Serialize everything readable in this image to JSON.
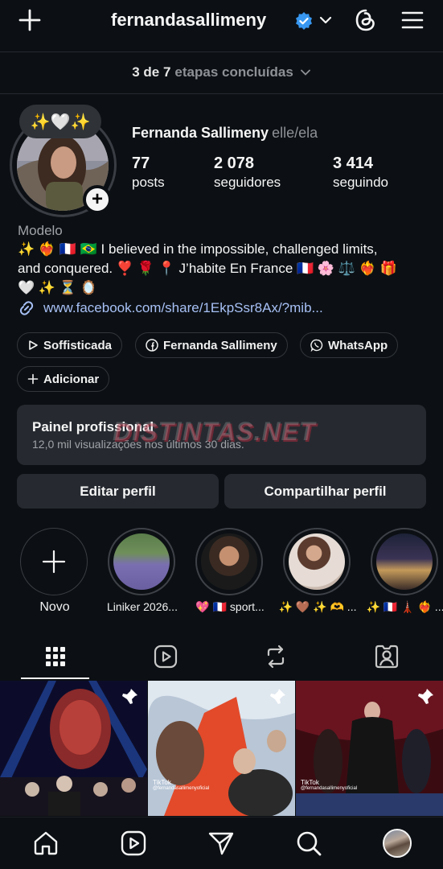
{
  "header": {
    "username": "fernandasallimeny"
  },
  "steps": {
    "count": "3 de 7",
    "text": "etapas concluídas"
  },
  "profile": {
    "note_emoji": "✨🤍✨",
    "full_name": "Fernanda Sallimeny",
    "pronouns": "elle/ela",
    "stats": [
      {
        "value": "77",
        "label": "posts"
      },
      {
        "value": "2 078",
        "label": "seguidores"
      },
      {
        "value": "3 414",
        "label": "seguindo"
      }
    ],
    "category": "Modelo",
    "bio_line1": "✨ ❤️‍🔥 🇫🇷 🇧🇷 I believed in the impossible, challenged limits,",
    "bio_line2": "and conquered. ❣️ 🌹 📍 J’habite En France 🇫🇷 🌸 ⚖️ ❤️‍🔥 🎁",
    "bio_line3": "🤍 ✨ ⏳ 🪞",
    "link": "www.facebook.com/share/1EkpSsr8Ax/?mib..."
  },
  "chips": [
    {
      "label": "Soffisticada",
      "icon": "play-icon"
    },
    {
      "label": "Fernanda Sallimeny",
      "icon": "facebook-icon"
    },
    {
      "label": "WhatsApp",
      "icon": "whatsapp-icon"
    },
    {
      "label": "Adicionar",
      "icon": "plus-icon"
    }
  ],
  "pro_panel": {
    "title": "Painel profissional",
    "subtitle": "12,0 mil visualizações nos últimos 30 dias."
  },
  "watermark": "DISTINTAS.NET",
  "buttons": {
    "edit": "Editar perfil",
    "share": "Compartilhar perfil"
  },
  "highlights": [
    {
      "label": "Novo"
    },
    {
      "label": "Liniker 2026..."
    },
    {
      "label": "💖 🇫🇷 sport..."
    },
    {
      "label": "✨ 🤎 ✨ 🫶 ..."
    },
    {
      "label": "✨ 🇫🇷 🗼 ❤️‍🔥 ..."
    }
  ],
  "tabs": [
    "grid-icon",
    "reels-icon",
    "reposts-icon",
    "tagged-icon"
  ],
  "grid_captions": {
    "tile2": "TikTok",
    "tile2_handle": "@fernandasallimenyoficial",
    "tile3": "TikTok",
    "tile3_handle": "@fernandasallimenyoficial"
  },
  "colors": {
    "background": "#0c1014",
    "surface": "#262a30",
    "verified": "#3897f0",
    "link": "#a7c0f5"
  }
}
